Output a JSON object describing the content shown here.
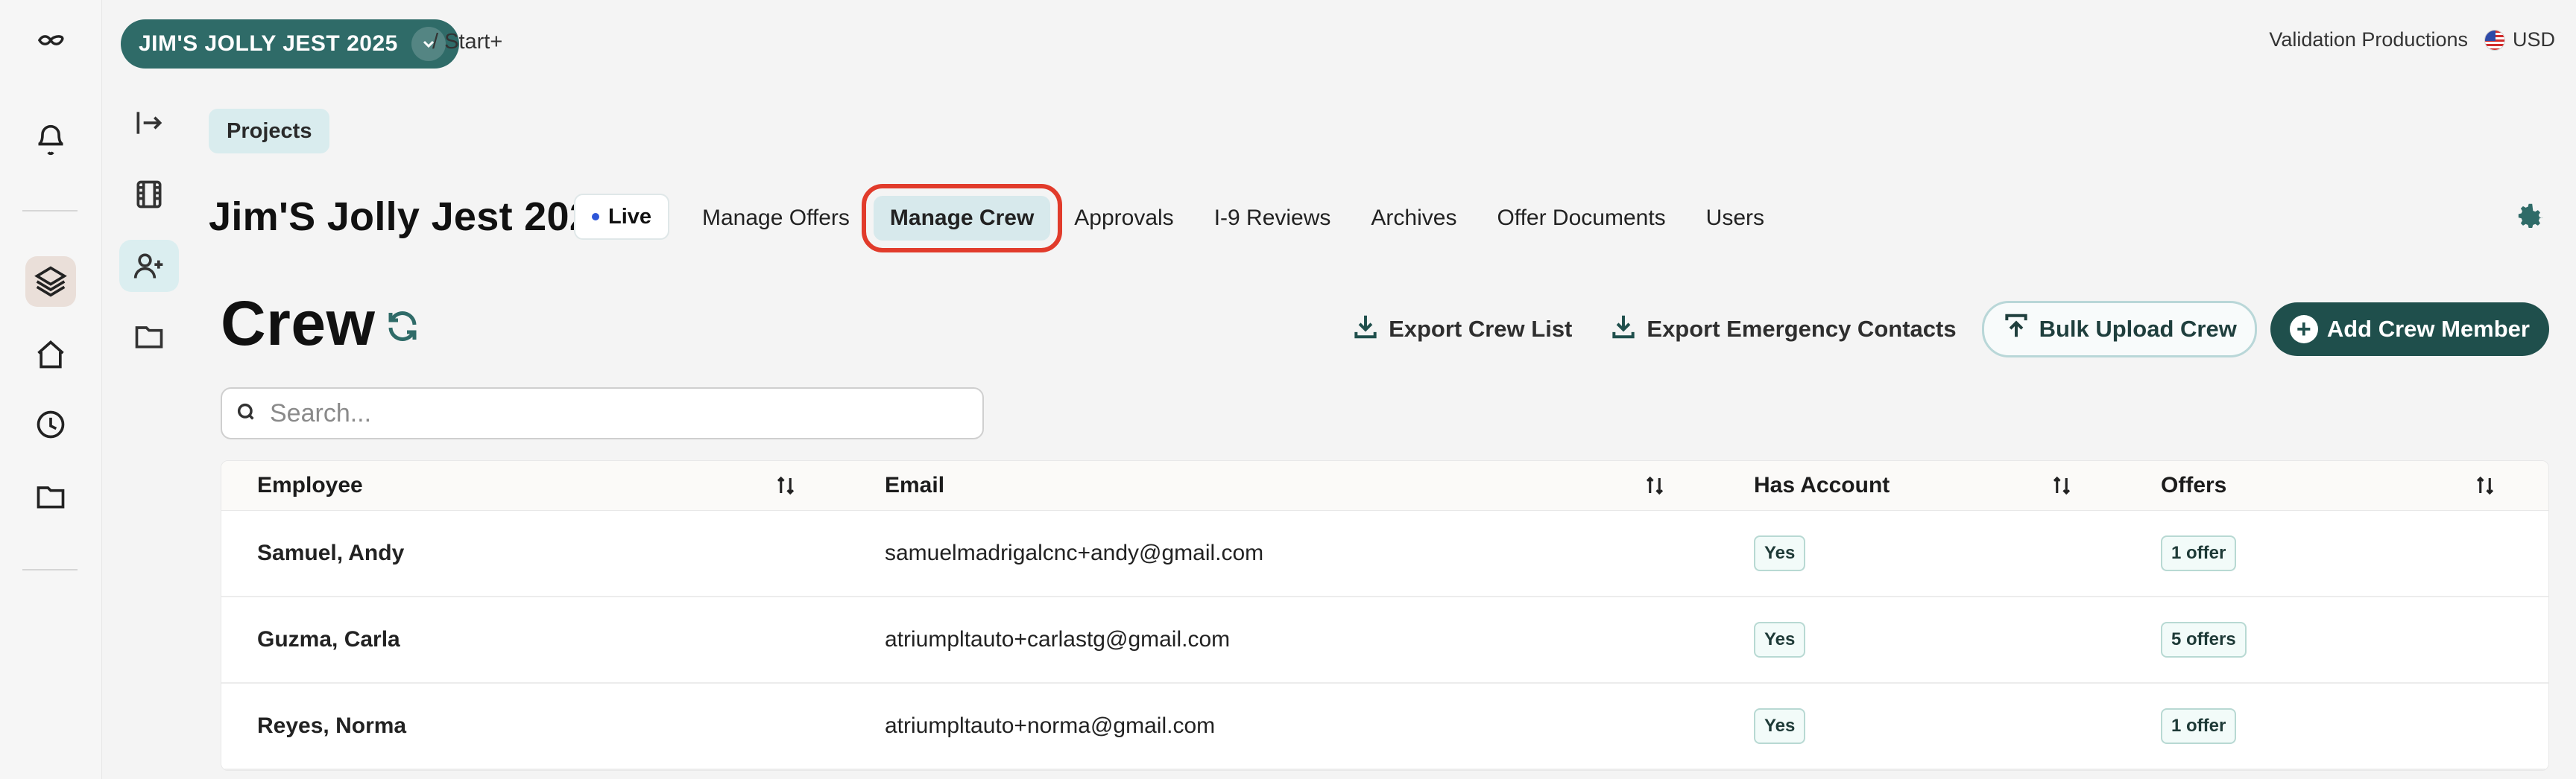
{
  "app": {
    "project_pill": "JIM'S JOLLY JEST 2025",
    "breadcrumb": "/ Start+",
    "company": "Validation Productions",
    "currency": "USD"
  },
  "nav": {
    "projects_chip": "Projects"
  },
  "project": {
    "title": "Jim'S Jolly Jest 2025",
    "status": "Live"
  },
  "tabs": [
    {
      "label": "Manage Offers"
    },
    {
      "label": "Manage Crew"
    },
    {
      "label": "Approvals"
    },
    {
      "label": "I-9 Reviews"
    },
    {
      "label": "Archives"
    },
    {
      "label": "Offer Documents"
    },
    {
      "label": "Users"
    }
  ],
  "crew": {
    "title": "Crew",
    "export_list": "Export Crew List",
    "export_emergency": "Export Emergency Contacts",
    "bulk_upload": "Bulk Upload Crew",
    "add_member": "Add Crew Member",
    "search_placeholder": "Search..."
  },
  "table": {
    "headers": [
      "Employee",
      "Email",
      "Has Account",
      "Offers"
    ],
    "rows": [
      {
        "employee": "Samuel, Andy",
        "email": "samuelmadrigalcnc+andy@gmail.com",
        "has_account": "Yes",
        "offers": "1 offer"
      },
      {
        "employee": "Guzma, Carla",
        "email": "atriumpltauto+carlastg@gmail.com",
        "has_account": "Yes",
        "offers": "5 offers"
      },
      {
        "employee": "Reyes, Norma",
        "email": "atriumpltauto+norma@gmail.com",
        "has_account": "Yes",
        "offers": "1 offer"
      }
    ]
  },
  "colors": {
    "accent": "#2f6b68",
    "accent_dark": "#1f4f4c",
    "highlight": "#e13b2b"
  },
  "icons": {
    "logo": "infinity-logo-icon",
    "bell": "bell-icon",
    "layers": "layers-icon",
    "home": "home-icon",
    "clock": "clock-icon",
    "folder": "folder-icon",
    "collapse": "collapse-sidebar-icon",
    "film": "film-icon",
    "user_plus": "user-plus-icon",
    "gear": "gear-icon",
    "refresh": "refresh-icon",
    "download": "download-icon",
    "upload": "upload-icon",
    "search": "search-icon",
    "sort": "sort-icon",
    "plus": "plus-icon"
  }
}
